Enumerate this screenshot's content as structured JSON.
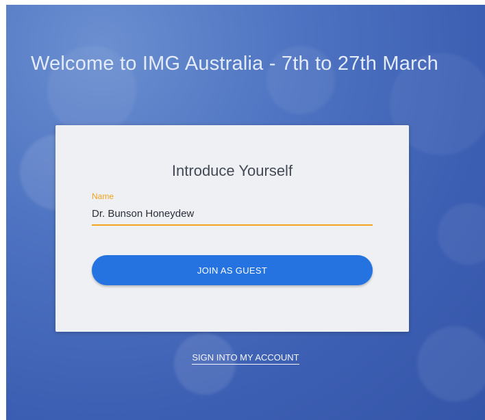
{
  "page": {
    "welcome_text": "Welcome to IMG Australia - 7th to 27th March"
  },
  "card": {
    "title": "Introduce Yourself",
    "name_label": "Name",
    "name_value": "Dr. Bunson Honeydew",
    "join_button_label": "JOIN AS GUEST"
  },
  "footer": {
    "sign_in_link": "SIGN INTO MY ACCOUNT"
  },
  "colors": {
    "accent_orange": "#f2a21c",
    "primary_blue": "#2473e0",
    "background_blue": "#4f74c2"
  }
}
